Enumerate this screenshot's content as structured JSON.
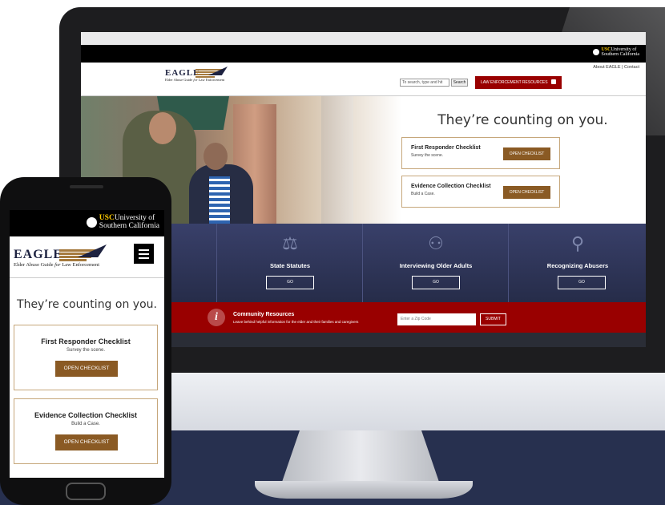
{
  "usc": {
    "abbr": "USC",
    "name_line1": "University of",
    "name_line2": "Southern California"
  },
  "eagle": {
    "word": "EAGLE",
    "tagline_pre": "Elder Abuse Guide ",
    "tagline_for": "for",
    "tagline_post": " Law Enforcement"
  },
  "header": {
    "about": "About EAGLE",
    "separator": "|",
    "contact": "Contact",
    "search_placeholder": "To search, type and hit",
    "search_button": "Search",
    "law_button": "LAW ENFORCEMENT RESOURCES"
  },
  "hero": {
    "title": "They’re counting on you.",
    "cards": [
      {
        "title": "First Responder Checklist",
        "subtitle": "Survey the scene.",
        "button": "OPEN CHECKLIST"
      },
      {
        "title": "Evidence Collection Checklist",
        "subtitle": "Build a Case.",
        "button": "OPEN CHECKLIST"
      }
    ]
  },
  "nav": {
    "partial_label": "w",
    "items": [
      {
        "label": "State Statutes",
        "button": "GO",
        "icon": "gavel-icon"
      },
      {
        "label": "Interviewing Older Adults",
        "button": "GO",
        "icon": "interview-icon"
      },
      {
        "label": "Recognizing Abusers",
        "button": "GO",
        "icon": "magnifier-icon"
      }
    ]
  },
  "community": {
    "title": "Community Resources",
    "subtitle": "Leave behind helpful information for the elder and their families and caregivers",
    "zip_placeholder": "Enter a Zip Code",
    "submit": "SUBMIT"
  },
  "colors": {
    "usc_red": "#990000",
    "navy": "#27304f",
    "brown_button": "#8a5a24",
    "card_border": "#c6a77b",
    "usc_gold": "#ffcc00"
  }
}
